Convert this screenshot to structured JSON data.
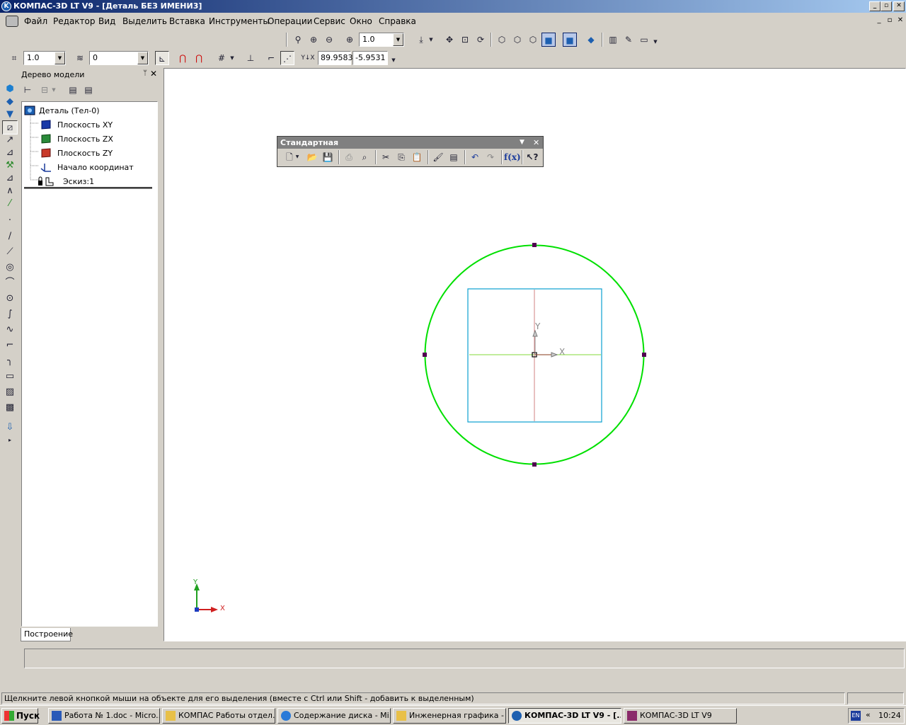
{
  "window": {
    "title": "КОМПАС-3D LT V9 - [Деталь БЕЗ ИМЕНИ3]",
    "app_icon": "kompas-logo-icon",
    "controls": [
      "_",
      "▫",
      "✕"
    ]
  },
  "menu": {
    "items": [
      "Файл",
      "Редактор",
      "Вид",
      "Выделить",
      "Вставка",
      "Инструменты",
      "Операции",
      "Сервис",
      "Окно",
      "Справка"
    ],
    "mdi_controls": [
      "_",
      "▫",
      "✕"
    ]
  },
  "view_toolbar": {
    "zoom_value": "1.0"
  },
  "snap_toolbar": {
    "step_value": "1.0",
    "layer_value": "0",
    "coord_label": "Y↓X",
    "x_value": "89.9583",
    "y_value": "-5.9531"
  },
  "tree_panel": {
    "title": "Дерево модели",
    "pin": "ᛘ",
    "close": "✕",
    "nodes": [
      {
        "label": "Деталь (Тел-0)",
        "icon": "part-icon"
      },
      {
        "label": "Плоскость XY",
        "icon": "plane-xy-icon"
      },
      {
        "label": "Плоскость ZX",
        "icon": "plane-zx-icon"
      },
      {
        "label": "Плоскость ZY",
        "icon": "plane-zy-icon"
      },
      {
        "label": "Начало координат",
        "icon": "origin-icon"
      },
      {
        "label": "Эскиз:1",
        "icon": "sketch-icon"
      }
    ],
    "tab": "Построение"
  },
  "floating_toolbar": {
    "title": "Стандартная",
    "fx_label": "f(x)"
  },
  "canvas": {
    "axis_y_label": "Y",
    "axis_x_label": "X",
    "colors": {
      "circle": "#00e000",
      "rect": "#0aa0d0",
      "horizontal_axis": "#9ce060",
      "vertical_axis": "#d08080"
    }
  },
  "status": {
    "message": "Щелкните левой кнопкой мыши на объекте для его выделения (вместе с Ctrl или Shift - добавить к выделенным)"
  },
  "taskbar": {
    "start": "Пуск",
    "tasks": [
      {
        "label": "Работа № 1.doc - Micro...",
        "icon": "word-icon",
        "active": false
      },
      {
        "label": "КОМПАС Работы отдел...",
        "icon": "folder-icon",
        "active": false
      },
      {
        "label": "Содержание диска - Mi...",
        "icon": "ie-icon",
        "active": false
      },
      {
        "label": "Инженерная графика - ...",
        "icon": "folder-icon",
        "active": false
      },
      {
        "label": "КОМПАС-3D LT V9 - [...",
        "icon": "kompas-logo-icon",
        "active": true
      },
      {
        "label": "КОМПАС-3D LT V9",
        "icon": "book-icon",
        "active": false
      }
    ],
    "lang": "EN",
    "tray_chevron": "«",
    "clock": "10:24"
  }
}
